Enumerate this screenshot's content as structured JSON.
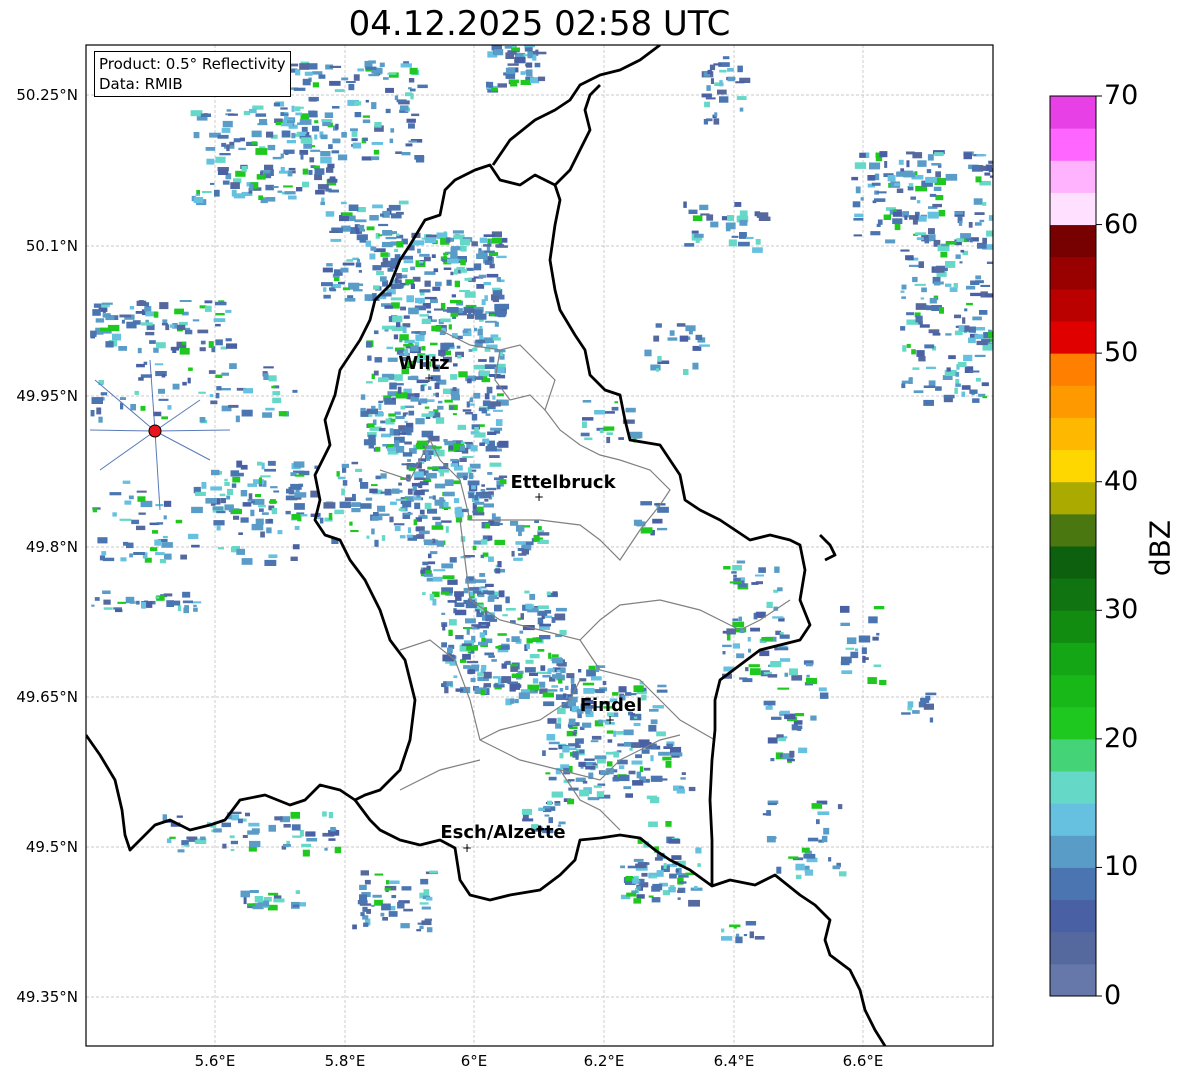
{
  "title": "04.12.2025 02:58 UTC",
  "info": {
    "product_line": "Product: 0.5° Reflectivity",
    "data_line": "Data: RMIB"
  },
  "map": {
    "lon_ticks": [
      "5.6°E",
      "5.8°E",
      "6°E",
      "6.2°E",
      "6.4°E",
      "6.6°E"
    ],
    "lat_ticks": [
      "50.25°N",
      "50.1°N",
      "49.95°N",
      "49.8°N",
      "49.65°N",
      "49.5°N",
      "49.35°N"
    ],
    "cities": [
      {
        "name": "Wiltz"
      },
      {
        "name": "Ettelbruck"
      },
      {
        "name": "Findel"
      },
      {
        "name": "Esch/Alzette"
      }
    ],
    "radar_site_color": "#e8141e",
    "border_color": "#000000",
    "canton_color": "#808080",
    "grid": true
  },
  "colorbar": {
    "label": "dBZ",
    "ticks": [
      "0",
      "10",
      "20",
      "30",
      "40",
      "50",
      "60",
      "70"
    ],
    "min": 0,
    "max": 70,
    "step": 2.5,
    "colors": [
      "#6677aa",
      "#55699f",
      "#4a60a5",
      "#4a75b0",
      "#5a9cc8",
      "#66c0e0",
      "#66d8c8",
      "#44d477",
      "#1fc81e",
      "#18b818",
      "#14a614",
      "#118c11",
      "#107510",
      "#0d600d",
      "#4a7710",
      "#aaaa00",
      "#ffd700",
      "#ffb800",
      "#ff9900",
      "#ff7f00",
      "#e00000",
      "#bb0000",
      "#990000",
      "#770000",
      "#ffe0ff",
      "#ffb3ff",
      "#ff66ff",
      "#e640e6"
    ]
  }
}
